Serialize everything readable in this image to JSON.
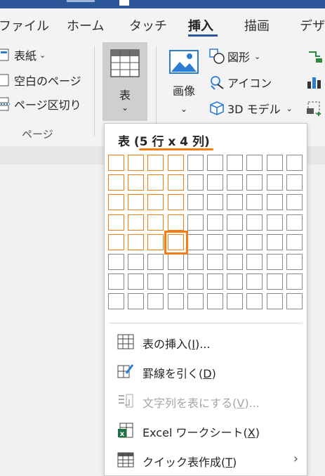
{
  "tabs": [
    {
      "label": "ファイル",
      "active": false
    },
    {
      "label": "ホーム",
      "active": false
    },
    {
      "label": "タッチ",
      "active": false
    },
    {
      "label": "挿入",
      "active": true
    },
    {
      "label": "描画",
      "active": false
    },
    {
      "label": "デザ",
      "active": false
    }
  ],
  "ribbon": {
    "pages_group": {
      "cover": "表紙",
      "blank": "空白のページ",
      "break": "ページ区切り",
      "label": "ページ"
    },
    "table_button": "表",
    "picture_button": "画像",
    "shapes": "図形",
    "icons": "アイコン",
    "models3d": "3D モデル"
  },
  "dropdown": {
    "title_prefix": "表 ",
    "title_size": "(5 行 x 4 列)",
    "grid_cols": 10,
    "grid_rows": 8,
    "selected_rows": 5,
    "selected_cols": 4,
    "menu": [
      {
        "label_main": "表の挿入(",
        "key": "I",
        "label_tail": ")...",
        "icon": "table-grid-icon",
        "disabled": false
      },
      {
        "label_main": "罫線を引く(",
        "key": "D",
        "label_tail": ")",
        "icon": "draw-table-icon",
        "disabled": false
      },
      {
        "label_main": "文字列を表にする(",
        "key": "V",
        "label_tail": ")...",
        "icon": "text-to-table-icon",
        "disabled": true
      },
      {
        "label_main": "Excel ワークシート(",
        "key": "X",
        "label_tail": ")",
        "icon": "excel-icon",
        "disabled": false
      },
      {
        "label_main": "クイック表作成(",
        "key": "T",
        "label_tail": ")",
        "icon": "quick-table-icon",
        "disabled": false,
        "submenu": true
      }
    ]
  },
  "colors": {
    "accent": "#f57d14",
    "tab_active": "#2b579a"
  }
}
